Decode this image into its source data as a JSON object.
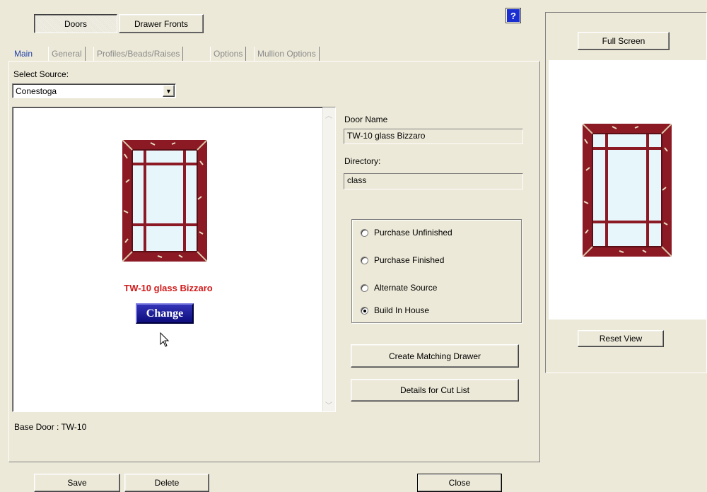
{
  "top_tabs": {
    "doors": "Doors",
    "drawer_fronts": "Drawer Fronts"
  },
  "help_label": "?",
  "tabs": [
    "Main",
    "General",
    "Profiles/Beads/Raises",
    "Options",
    "Mullion Options"
  ],
  "source": {
    "label": "Select Source:",
    "value": "Conestoga"
  },
  "preview": {
    "door_title": "TW-10 glass Bizzaro",
    "change_label": "Change"
  },
  "base_door": "Base Door : TW-10",
  "door_name": {
    "label": "Door Name",
    "value": "TW-10 glass Bizzaro"
  },
  "directory": {
    "label": "Directory:",
    "value": "class"
  },
  "purchase_options": [
    {
      "label": "Purchase Unfinished",
      "selected": false
    },
    {
      "label": "Purchase Finished",
      "selected": false
    },
    {
      "label": "Alternate Source",
      "selected": false
    },
    {
      "label": "Build In House",
      "selected": true
    }
  ],
  "buttons": {
    "create_matching_drawer": "Create Matching Drawer",
    "details_cut_list": "Details for Cut List",
    "save": "Save",
    "delete": "Delete",
    "close": "Close"
  },
  "right_panel": {
    "full_screen": "Full Screen",
    "reset_view": "Reset View"
  },
  "colors": {
    "accent_red": "#d11a1a",
    "change_blue": "#0d0d7c",
    "door_frame": "#8b1a24",
    "glass": "#e6f6fb"
  }
}
